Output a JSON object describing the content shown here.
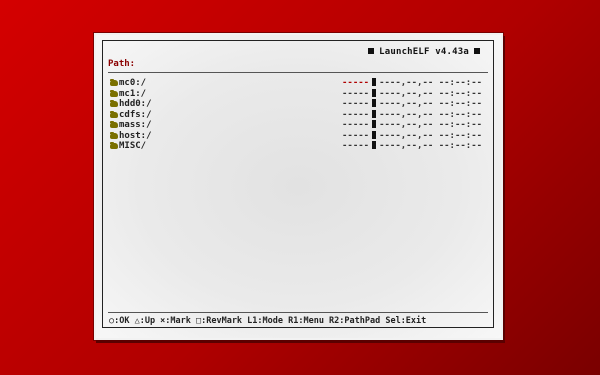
{
  "app": {
    "title": "LaunchELF v4.43a"
  },
  "path": {
    "label": "Path:"
  },
  "devices": [
    {
      "name": "mc0:/",
      "size": "-----",
      "date": "----,--,--",
      "time": "--:--:--"
    },
    {
      "name": "mc1:/",
      "size": "-----",
      "date": "----,--,--",
      "time": "--:--:--"
    },
    {
      "name": "hdd0:/",
      "size": "-----",
      "date": "----,--,--",
      "time": "--:--:--"
    },
    {
      "name": "cdfs:/",
      "size": "-----",
      "date": "----,--,--",
      "time": "--:--:--"
    },
    {
      "name": "mass:/",
      "size": "-----",
      "date": "----,--,--",
      "time": "--:--:--"
    },
    {
      "name": "host:/",
      "size": "-----",
      "date": "----,--,--",
      "time": "--:--:--"
    },
    {
      "name": "MISC/",
      "size": "-----",
      "date": "----,--,--",
      "time": "--:--:--"
    }
  ],
  "footer": {
    "hints": "○:OK △:Up ×:Mark □:RevMark L1:Mode R1:Menu R2:PathPad Sel:Exit"
  },
  "colors": {
    "accent": "#8b0000",
    "background": "#c00000",
    "folder": "#7a7000"
  },
  "icons": {
    "folder": "folder-icon",
    "title_marks": "square-icon"
  }
}
